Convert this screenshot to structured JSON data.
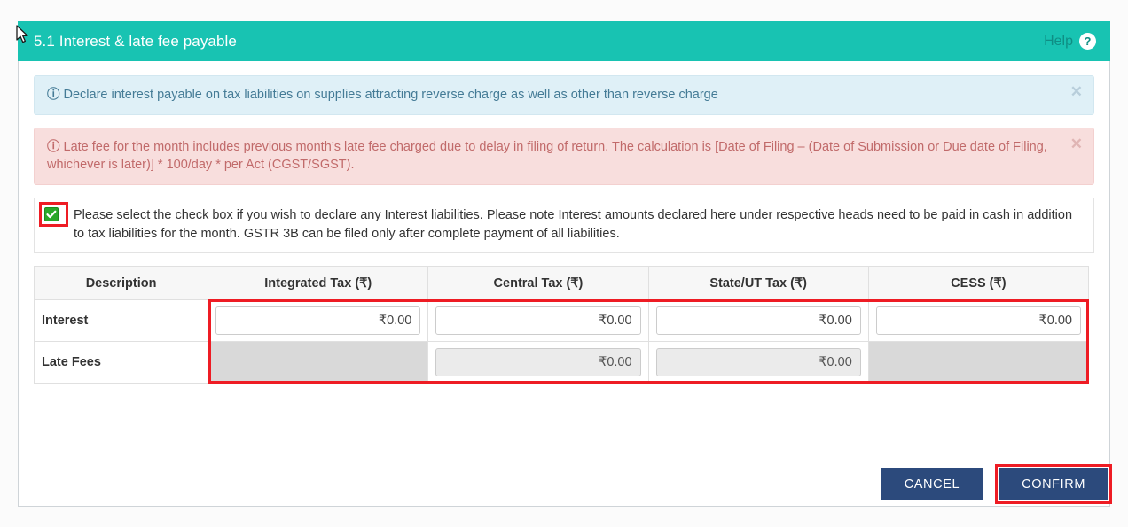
{
  "panel": {
    "title": "5.1 Interest & late fee payable",
    "help_label": "Help",
    "help_icon": "question-circle-icon"
  },
  "alerts": [
    {
      "type": "info",
      "icon": "info-circle-icon",
      "text": "Declare interest payable on tax liabilities on supplies attracting reverse charge as well as other than reverse charge",
      "close_label": "✕"
    },
    {
      "type": "danger",
      "icon": "info-circle-icon",
      "text": "Late fee for the month includes previous month’s late fee charged due to delay in filing of return. The calculation is [Date of Filing – (Date of Submission or Due date of Filing, whichever is later)] * 100/day * per Act (CGST/SGST).",
      "close_label": "✕"
    }
  ],
  "declaration": {
    "checked": true,
    "text": "Please select the check box if you wish to declare any Interest liabilities. Please note Interest amounts declared here under respective heads need to be paid in cash in addition to tax liabilities for the month. GSTR 3B can be filed only after complete payment of all liabilities."
  },
  "table": {
    "headers": [
      "Description",
      "Integrated Tax (₹)",
      "Central Tax (₹)",
      "State/UT Tax (₹)",
      "CESS (₹)"
    ],
    "rows": [
      {
        "description": "Interest",
        "cells": [
          {
            "kind": "input",
            "value": "₹0.00",
            "disabled": false
          },
          {
            "kind": "input",
            "value": "₹0.00",
            "disabled": false
          },
          {
            "kind": "input",
            "value": "₹0.00",
            "disabled": false
          },
          {
            "kind": "input",
            "value": "₹0.00",
            "disabled": false
          }
        ]
      },
      {
        "description": "Late Fees",
        "cells": [
          {
            "kind": "blocked",
            "value": "",
            "disabled": true
          },
          {
            "kind": "input",
            "value": "₹0.00",
            "disabled": true
          },
          {
            "kind": "input",
            "value": "₹0.00",
            "disabled": true
          },
          {
            "kind": "blocked",
            "value": "",
            "disabled": true
          }
        ]
      }
    ]
  },
  "footer": {
    "cancel_label": "CANCEL",
    "confirm_label": "CONFIRM"
  },
  "colors": {
    "header_teal": "#18c3b2",
    "button_navy": "#2c4a7c",
    "highlight_red": "#ee1c24",
    "checkbox_green": "#2aa72a",
    "info_bg": "#dff0f7",
    "danger_bg": "#f8dedd"
  }
}
